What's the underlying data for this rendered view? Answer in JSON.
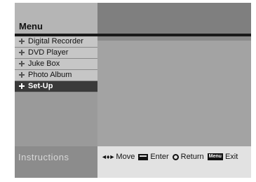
{
  "header": {
    "title": "Menu"
  },
  "sidebar": {
    "items": [
      {
        "label": "Digital Recorder",
        "icon": "plus-bullet-icon",
        "active": false
      },
      {
        "label": "DVD Player",
        "icon": "plus-bullet-icon",
        "active": false
      },
      {
        "label": "Juke Box",
        "icon": "plus-bullet-icon",
        "active": false
      },
      {
        "label": "Photo Album",
        "icon": "plus-bullet-icon",
        "active": false
      },
      {
        "label": "Set-Up",
        "icon": "plus-bullet-icon",
        "active": true
      }
    ]
  },
  "footer": {
    "instructions_label": "Instructions",
    "move_icon": "◄♦►",
    "move_label": "Move",
    "enter_label": "Enter",
    "return_label": "Return",
    "menu_key_label": "Menu",
    "exit_label": "Exit"
  },
  "colors": {
    "screen_bg": "#8f8f8f",
    "header_left": "#b5b5b5",
    "header_right": "#7f7f7f",
    "item_bg": "#c6c6c6",
    "item_active_bg": "#3a3a3a",
    "footer_bg": "#e2e2e2"
  }
}
